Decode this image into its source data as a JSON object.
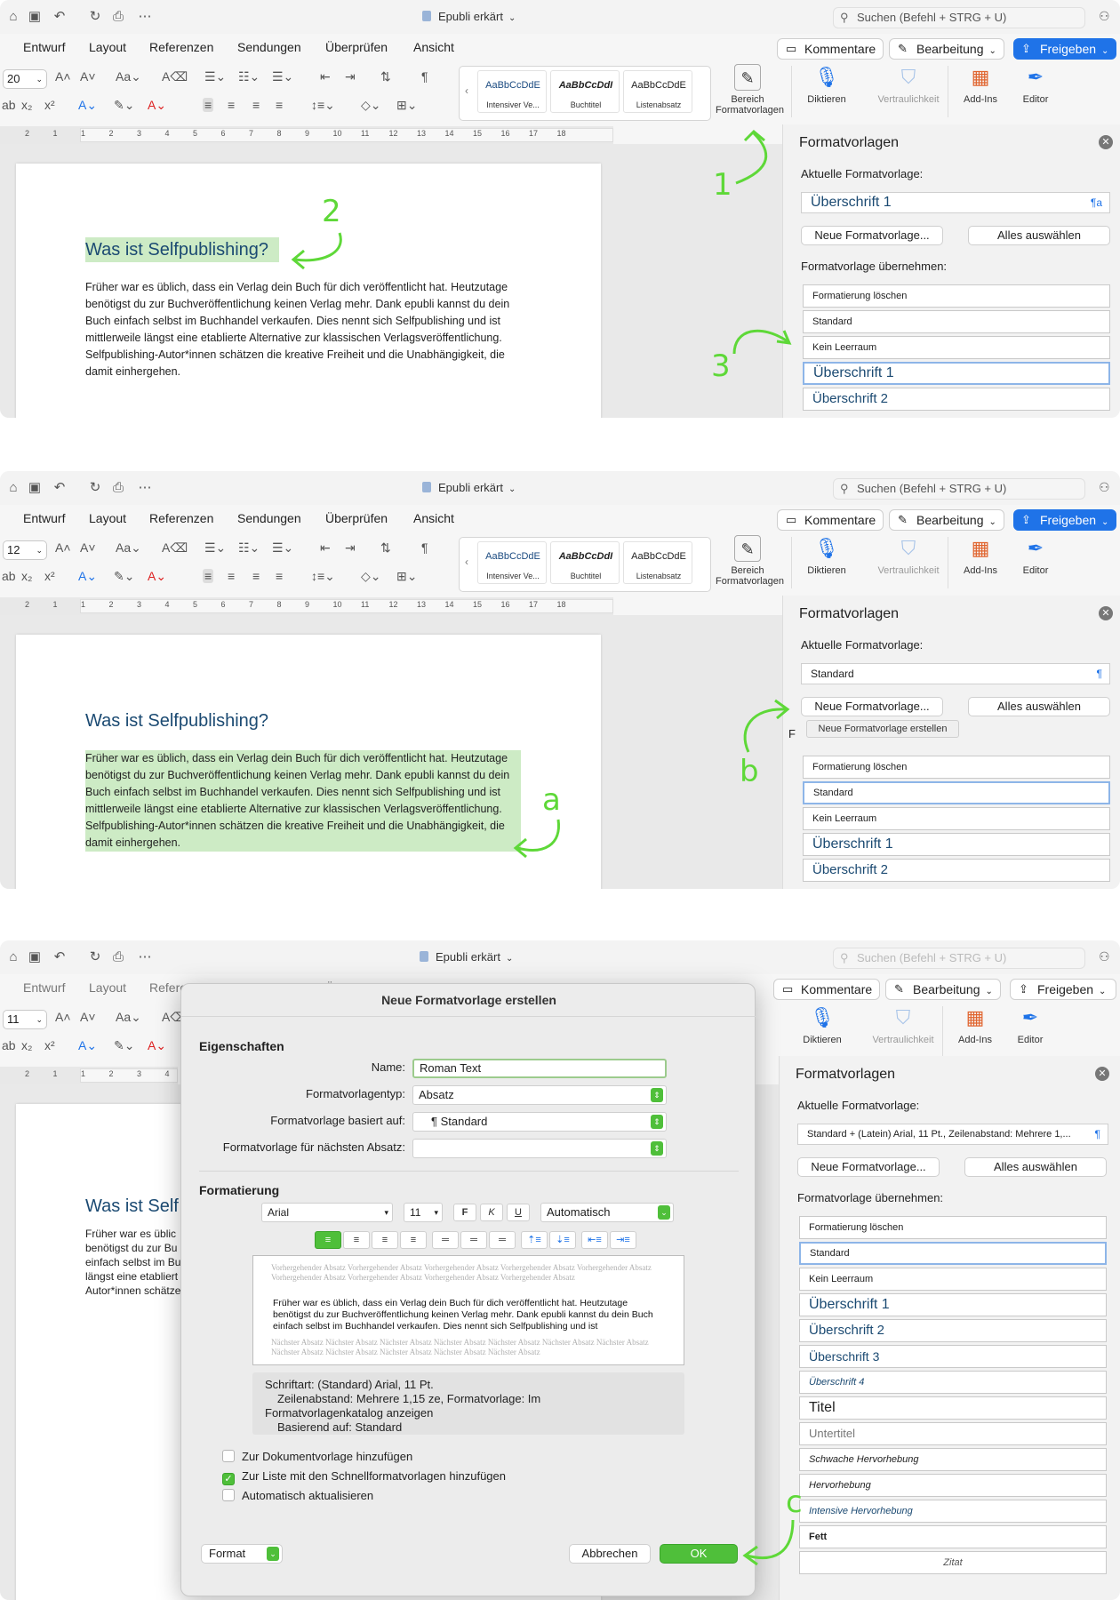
{
  "app": {
    "window_title": "Epubli erkärt",
    "search_placeholder": "Suchen (Befehl + STRG + U)",
    "tabs": [
      "Entwurf",
      "Layout",
      "Referenzen",
      "Sendungen",
      "Überprüfen",
      "Ansicht"
    ],
    "buttons": {
      "kommentare": "Kommentare",
      "bearbeitung": "Bearbeitung",
      "freigeben": "Freigeben"
    },
    "styles_gallery": [
      {
        "sample": "AaBbCcDdE",
        "label": "Intensiver Ve..."
      },
      {
        "sample": "AaBbCcDdI",
        "label": "Buchtitel"
      },
      {
        "sample": "AaBbCcDdE",
        "label": "Listenabsatz"
      }
    ],
    "ribbon_tools": {
      "bereich": "Bereich Formatvorlagen",
      "diktieren": "Diktieren",
      "vertraulichkeit": "Vertraulichkeit",
      "addins": "Add-Ins",
      "editor": "Editor"
    },
    "ruler_numbers": [
      "2",
      "1",
      "1",
      "2",
      "3",
      "4",
      "5",
      "6",
      "7",
      "8",
      "9",
      "10",
      "11",
      "12",
      "13",
      "14",
      "15",
      "16",
      "17",
      "18"
    ],
    "colors": {
      "accent_blue": "#1f73e8",
      "heading_blue": "#1b4a72",
      "highlight_green": "#cdebc5",
      "annotation_green": "#5ed838"
    }
  },
  "document": {
    "heading": "Was ist Selfpublishing?",
    "heading_cut": "Was ist Self",
    "body_lines": [
      "Früher war es üblich, dass ein Verlag dein Buch für dich veröffentlicht hat. Heutzutage",
      "benötigst du zur Buchveröffentlichung keinen Verlag mehr. Dank epubli kannst du dein",
      "Buch einfach selbst im Buchhandel verkaufen. Dies nennt sich Selfpublishing und ist",
      "mittlerweile längst eine etablierte Alternative zur klassischen Verlagsveröffentlichung.",
      "Selfpublishing-Autor*innen schätzen die kreative Freiheit und die Unabhängigkeit, die",
      "damit einhergehen."
    ],
    "body_cut": [
      "Früher war es üblic",
      "benötigst du zur Bu",
      "einfach selbst im Bu",
      "längst eine etabliert",
      "Autor*innen schätze"
    ]
  },
  "pane": {
    "title": "Formatvorlagen",
    "current_label": "Aktuelle Formatvorlage:",
    "new_style_button": "Neue Formatvorlage...",
    "select_all_button": "Alles auswählen",
    "apply_label": "Formatvorlage übernehmen:",
    "apply_label_cut": "F",
    "tooltip": "Neue Formatvorlage erstellen",
    "styles_short": [
      "Formatierung löschen",
      "Standard",
      "Kein Leerraum",
      "Überschrift 1",
      "Überschrift 2"
    ],
    "styles_long": [
      "Formatierung löschen",
      "Standard",
      "Kein Leerraum",
      "Überschrift 1",
      "Überschrift 2",
      "Überschrift 3",
      "Überschrift 4",
      "Titel",
      "Untertitel",
      "Schwache Hervorhebung",
      "Hervorhebung",
      "Intensive Hervorhebung",
      "Fett",
      "Zitat"
    ]
  },
  "screens": [
    {
      "font_size": "20",
      "current_style": "Überschrift 1",
      "current_icon": "¶a",
      "annotations": [
        "1",
        "2",
        "3"
      ]
    },
    {
      "font_size": "12",
      "current_style": "Standard",
      "current_icon": "¶",
      "annotations": [
        "a",
        "b"
      ]
    },
    {
      "font_size": "11",
      "current_style": "Standard + (Latein) Arial, 11 Pt., Zeilenabstand: Mehrere 1,...",
      "current_icon": "¶",
      "annotations": [
        "c"
      ]
    }
  ],
  "dialog": {
    "title": "Neue Formatvorlage erstellen",
    "section_properties": "Eigenschaften",
    "name_label": "Name:",
    "name_value": "Roman Text",
    "type_label": "Formatvorlagentyp:",
    "type_value": "Absatz",
    "based_label": "Formatvorlage basiert auf:",
    "based_value": "¶ Standard",
    "next_label": "Formatvorlage für nächsten Absatz:",
    "next_value": "",
    "section_formatting": "Formatierung",
    "font": "Arial",
    "size": "11",
    "bold": "F",
    "italic": "K",
    "underline": "U",
    "color": "Automatisch",
    "preview_prev": "Vorhergehender Absatz Vorhergehender Absatz Vorhergehender Absatz Vorhergehender Absatz Vorhergehender Absatz Vorhergehender Absatz Vorhergehender Absatz Vorhergehender Absatz Vorhergehender Absatz",
    "preview_text": "Früher war es üblich, dass ein Verlag dein Buch für dich veröffentlicht hat. Heutzutage benötigst du zur Buchveröffentlichung keinen Verlag mehr. Dank epubli kannst du dein Buch einfach selbst im Buchhandel verkaufen. Dies nennt sich Selfpublishing und ist",
    "preview_next": "Nächster Absatz Nächster Absatz Nächster Absatz Nächster Absatz Nächster Absatz Nächster Absatz Nächster Absatz Nächster Absatz Nächster Absatz Nächster Absatz Nächster Absatz Nächster Absatz",
    "description_lines": [
      "Schriftart: (Standard) Arial, 11 Pt.",
      "Zeilenabstand:  Mehrere 1,15 ze, Formatvorlage: Im",
      "Formatvorlagenkatalog anzeigen",
      "Basierend auf: Standard"
    ],
    "check_template": "Zur Dokumentvorlage hinzufügen",
    "check_quicklist": "Zur Liste mit den Schnellformatvorlagen hinzufügen",
    "check_auto": "Automatisch aktualisieren",
    "format_button": "Format",
    "cancel_button": "Abbrechen",
    "ok_button": "OK"
  }
}
